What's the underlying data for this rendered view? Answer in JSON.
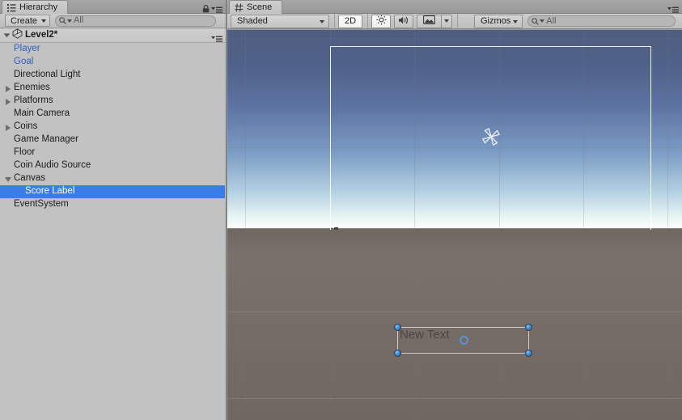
{
  "hierarchy": {
    "tab": {
      "label": "Hierarchy",
      "icon": "hierarchy-icon"
    },
    "lock_icon": "lock-icon",
    "menu_icon": "panel-menu-icon",
    "toolbar": {
      "create_label": "Create",
      "search_placeholder": "All",
      "search_value": "",
      "search_icon": "search-icon"
    },
    "scene_root": {
      "name": "Level2*",
      "icon": "unity-scene-icon",
      "expanded": true
    },
    "nodes": [
      {
        "label": "Player",
        "depth": 1,
        "arrow": "none",
        "prefab": true,
        "selected": false
      },
      {
        "label": "Goal",
        "depth": 1,
        "arrow": "none",
        "prefab": true,
        "selected": false
      },
      {
        "label": "Directional Light",
        "depth": 1,
        "arrow": "none",
        "prefab": false,
        "selected": false
      },
      {
        "label": "Enemies",
        "depth": 1,
        "arrow": "closed",
        "prefab": false,
        "selected": false
      },
      {
        "label": "Platforms",
        "depth": 1,
        "arrow": "closed",
        "prefab": false,
        "selected": false
      },
      {
        "label": "Main Camera",
        "depth": 1,
        "arrow": "none",
        "prefab": false,
        "selected": false
      },
      {
        "label": "Coins",
        "depth": 1,
        "arrow": "closed",
        "prefab": false,
        "selected": false
      },
      {
        "label": "Game Manager",
        "depth": 1,
        "arrow": "none",
        "prefab": false,
        "selected": false
      },
      {
        "label": "Floor",
        "depth": 1,
        "arrow": "none",
        "prefab": false,
        "selected": false
      },
      {
        "label": "Coin Audio Source",
        "depth": 1,
        "arrow": "none",
        "prefab": false,
        "selected": false
      },
      {
        "label": "Canvas",
        "depth": 1,
        "arrow": "open",
        "prefab": false,
        "selected": false
      },
      {
        "label": "Score Label",
        "depth": 2,
        "arrow": "none",
        "prefab": false,
        "selected": true
      },
      {
        "label": "EventSystem",
        "depth": 1,
        "arrow": "none",
        "prefab": false,
        "selected": false
      }
    ]
  },
  "scene": {
    "tab": {
      "label": "Scene",
      "icon": "scene-grid-icon"
    },
    "menu_icon": "panel-menu-icon",
    "toolbar": {
      "draw_mode": "Shaded",
      "toggle_2d": "2D",
      "toggle_2d_active": true,
      "lighting_icon": "sun-icon",
      "lighting_active": true,
      "audio_icon": "speaker-icon",
      "audio_active": false,
      "effects_icon": "image-icon",
      "effects_active": false,
      "gizmos_label": "Gizmos",
      "search_placeholder": "All",
      "search_value": "",
      "search_icon": "search-icon"
    },
    "viewport": {
      "light_gizmo": "directional-light-gizmo",
      "canvas_outline": "canvas-rect-outline",
      "selection": {
        "object_text": "New Text",
        "handle_icon": "rect-corner-handle",
        "pivot_icon": "pivot-circle-icon"
      }
    }
  },
  "colors": {
    "selection_blue": "#3a7ce8",
    "prefab_blue": "#2f5fbf",
    "panel_gray": "#c2c2c2",
    "sky_top": "#4e5e80",
    "ground": "#7a716b",
    "handle_blue": "#2f8ce8"
  }
}
